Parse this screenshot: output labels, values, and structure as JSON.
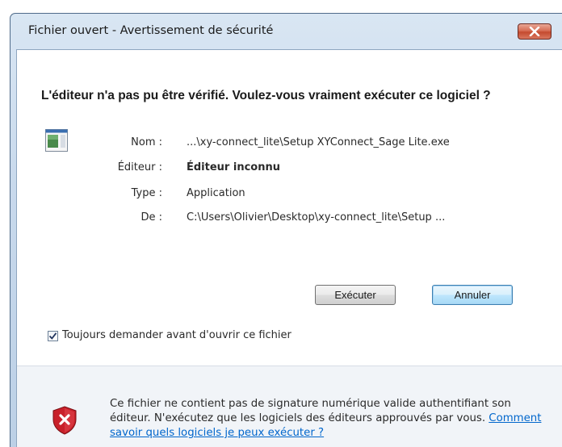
{
  "window": {
    "title": "Fichier ouvert - Avertissement de sécurité"
  },
  "heading": "L'éditeur n'a pas pu être vérifié. Voulez-vous vraiment exécuter ce logiciel ?",
  "properties": [
    {
      "label": "Nom :",
      "value": "...\\xy-connect_lite\\Setup XYConnect_Sage Lite.exe"
    },
    {
      "label": "Éditeur :",
      "value": "Éditeur inconnu"
    },
    {
      "label": "Type :",
      "value": "Application"
    },
    {
      "label": "De :",
      "value": "C:\\Users\\Olivier\\Desktop\\xy-connect_lite\\Setup ..."
    }
  ],
  "buttons": {
    "run": "Exécuter",
    "cancel": "Annuler"
  },
  "checkbox": {
    "label": "Toujours demander avant d'ouvrir ce fichier",
    "checked": true
  },
  "warning": {
    "text": "Ce fichier ne contient pas de signature numérique valide authentifiant son éditeur. N'exécutez que les logiciels des éditeurs approuvés par vous.",
    "link": "Comment savoir quels logiciels je peux exécuter ?"
  },
  "icons": {
    "close": "close-icon",
    "program": "program-icon",
    "shield": "shield-warning-icon",
    "check": "checkmark-icon"
  },
  "colors": {
    "link": "#0066cc",
    "close_button": "#c44a2f",
    "shield": "#c8202a"
  }
}
